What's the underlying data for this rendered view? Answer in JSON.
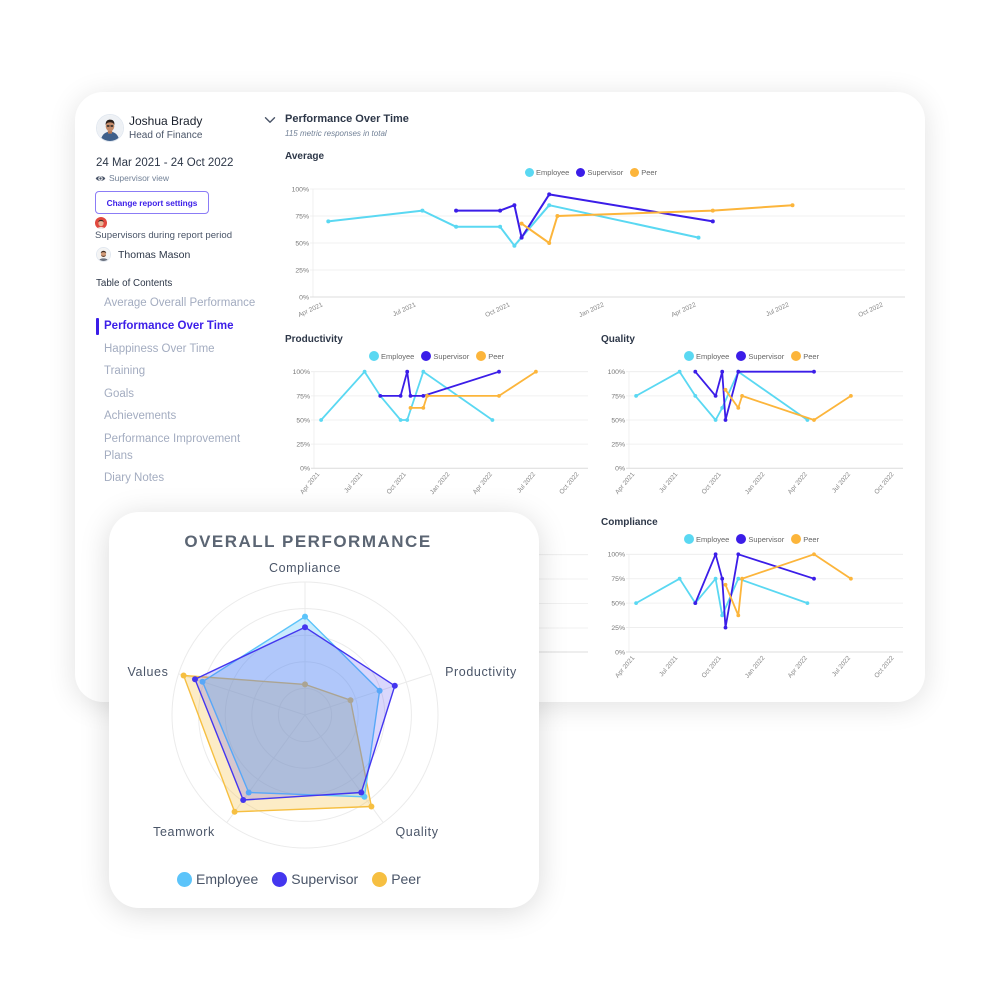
{
  "profile": {
    "name": "Joshua Brady",
    "role": "Head of Finance"
  },
  "report": {
    "date_range": "24 Mar 2021 - 24 Oct 2022",
    "view_label": "Supervisor view",
    "change_settings_label": "Change report settings",
    "supervisors_heading": "Supervisors during report period",
    "supervisors": [
      {
        "name": "Thomas Mason"
      }
    ]
  },
  "toc": {
    "heading": "Table of Contents",
    "active_index": 1,
    "items": [
      "Average Overall Performance",
      "Performance Over Time",
      "Happiness Over Time",
      "Training",
      "Goals",
      "Achievements",
      "Performance Improvement Plans",
      "Diary Notes"
    ]
  },
  "section": {
    "title": "Performance Over Time",
    "subtitle": "115 metric responses in total"
  },
  "colors": {
    "Employee": "#5ad8f2",
    "Supervisor": "#3b1de8",
    "Peer": "#fcb53b"
  },
  "radar_colors": {
    "Employee": "#5cc4fa",
    "Supervisor": "#4436ef",
    "Peer": "#f6bf41"
  },
  "chart_data": [
    {
      "type": "line",
      "title": "Average",
      "x_range": [
        "2021-03-24",
        "2022-10-24"
      ],
      "ylim": [
        0,
        100
      ],
      "legend": "top-center",
      "grid": true,
      "y_ticks": [
        {
          "label": "0%",
          "value": 0
        },
        {
          "label": "25%",
          "value": 25
        },
        {
          "label": "50%",
          "value": 50
        },
        {
          "label": "75%",
          "value": 75
        },
        {
          "label": "100%",
          "value": 100
        }
      ],
      "x_ticks": [
        {
          "label": "Apr 2021",
          "date": "2021-04-01"
        },
        {
          "label": "Jul 2021",
          "date": "2021-07-01"
        },
        {
          "label": "Oct 2021",
          "date": "2021-10-01"
        },
        {
          "label": "Jan 2022",
          "date": "2022-01-01"
        },
        {
          "label": "Apr 2022",
          "date": "2022-04-01"
        },
        {
          "label": "Jul 2022",
          "date": "2022-07-01"
        },
        {
          "label": "Oct 2022",
          "date": "2022-10-01"
        }
      ],
      "series": [
        {
          "name": "Employee",
          "points": [
            [
              "2021-04-08",
              70
            ],
            [
              "2021-07-09",
              80
            ],
            [
              "2021-08-11",
              65
            ],
            [
              "2021-09-23",
              65
            ],
            [
              "2021-10-07",
              47.5
            ],
            [
              "2021-11-10",
              85
            ],
            [
              "2022-04-05",
              55
            ]
          ]
        },
        {
          "name": "Supervisor",
          "points": [
            [
              "2021-08-11",
              80
            ],
            [
              "2021-09-23",
              80
            ],
            [
              "2021-10-07",
              85
            ],
            [
              "2021-10-14",
              55
            ],
            [
              "2021-11-10",
              95
            ],
            [
              "2022-04-19",
              70
            ]
          ]
        },
        {
          "name": "Peer",
          "points": [
            [
              "2021-10-14",
              68
            ],
            [
              "2021-11-10",
              50
            ],
            [
              "2021-11-18",
              75
            ],
            [
              "2022-04-19",
              80
            ],
            [
              "2022-07-06",
              85
            ]
          ]
        }
      ]
    },
    {
      "type": "line",
      "title": "Productivity",
      "x_range": [
        "2021-03-24",
        "2022-10-24"
      ],
      "ylim": [
        0,
        100
      ],
      "legend": "top-center",
      "grid": true,
      "y_ticks": [
        {
          "label": "0%",
          "value": 0
        },
        {
          "label": "25%",
          "value": 25
        },
        {
          "label": "50%",
          "value": 50
        },
        {
          "label": "75%",
          "value": 75
        },
        {
          "label": "100%",
          "value": 100
        }
      ],
      "x_ticks": [
        {
          "label": "Apr 2021",
          "date": "2021-04-01"
        },
        {
          "label": "Jul 2021",
          "date": "2021-07-01"
        },
        {
          "label": "Oct 2021",
          "date": "2021-10-01"
        },
        {
          "label": "Jan 2022",
          "date": "2022-01-01"
        },
        {
          "label": "Apr 2022",
          "date": "2022-04-01"
        },
        {
          "label": "Jul 2022",
          "date": "2022-07-01"
        },
        {
          "label": "Oct 2022",
          "date": "2022-10-01"
        }
      ],
      "series": [
        {
          "name": "Employee",
          "points": [
            [
              "2021-04-08",
              50
            ],
            [
              "2021-07-09",
              100
            ],
            [
              "2021-08-11",
              75
            ],
            [
              "2021-09-23",
              50
            ],
            [
              "2021-10-07",
              50
            ],
            [
              "2021-11-10",
              100
            ],
            [
              "2022-04-05",
              50
            ]
          ]
        },
        {
          "name": "Supervisor",
          "points": [
            [
              "2021-08-11",
              75
            ],
            [
              "2021-09-23",
              75
            ],
            [
              "2021-10-07",
              100
            ],
            [
              "2021-10-14",
              75
            ],
            [
              "2021-11-10",
              75
            ],
            [
              "2022-04-19",
              100
            ]
          ]
        },
        {
          "name": "Peer",
          "points": [
            [
              "2021-10-14",
              62.5
            ],
            [
              "2021-11-10",
              62.5
            ],
            [
              "2021-11-18",
              75
            ],
            [
              "2022-04-19",
              75
            ],
            [
              "2022-07-06",
              100
            ]
          ]
        }
      ]
    },
    {
      "type": "line",
      "title": "Quality",
      "x_range": [
        "2021-03-24",
        "2022-10-24"
      ],
      "ylim": [
        0,
        100
      ],
      "legend": "top-center",
      "grid": true,
      "y_ticks": [
        {
          "label": "0%",
          "value": 0
        },
        {
          "label": "25%",
          "value": 25
        },
        {
          "label": "50%",
          "value": 50
        },
        {
          "label": "75%",
          "value": 75
        },
        {
          "label": "100%",
          "value": 100
        }
      ],
      "x_ticks": [
        {
          "label": "Apr 2021",
          "date": "2021-04-01"
        },
        {
          "label": "Jul 2021",
          "date": "2021-07-01"
        },
        {
          "label": "Oct 2021",
          "date": "2021-10-01"
        },
        {
          "label": "Jan 2022",
          "date": "2022-01-01"
        },
        {
          "label": "Apr 2022",
          "date": "2022-04-01"
        },
        {
          "label": "Jul 2022",
          "date": "2022-07-01"
        },
        {
          "label": "Oct 2022",
          "date": "2022-10-01"
        }
      ],
      "series": [
        {
          "name": "Employee",
          "points": [
            [
              "2021-04-08",
              75
            ],
            [
              "2021-07-09",
              100
            ],
            [
              "2021-08-11",
              75
            ],
            [
              "2021-09-23",
              50
            ],
            [
              "2021-10-07",
              62.5
            ],
            [
              "2021-11-10",
              100
            ],
            [
              "2022-04-05",
              50
            ]
          ]
        },
        {
          "name": "Supervisor",
          "points": [
            [
              "2021-08-11",
              100
            ],
            [
              "2021-09-23",
              75
            ],
            [
              "2021-10-07",
              100
            ],
            [
              "2021-10-14",
              50
            ],
            [
              "2021-11-10",
              100
            ],
            [
              "2022-04-19",
              100
            ]
          ]
        },
        {
          "name": "Peer",
          "points": [
            [
              "2021-10-14",
              81.25
            ],
            [
              "2021-11-10",
              62.5
            ],
            [
              "2021-11-18",
              75
            ],
            [
              "2022-04-19",
              50
            ],
            [
              "2022-07-06",
              75
            ]
          ]
        }
      ]
    },
    {
      "type": "line",
      "title": "Compliance",
      "x_range": [
        "2021-03-24",
        "2022-10-24"
      ],
      "ylim": [
        0,
        100
      ],
      "legend": "top-center",
      "grid": true,
      "y_ticks": [
        {
          "label": "0%",
          "value": 0
        },
        {
          "label": "25%",
          "value": 25
        },
        {
          "label": "50%",
          "value": 50
        },
        {
          "label": "75%",
          "value": 75
        },
        {
          "label": "100%",
          "value": 100
        }
      ],
      "x_ticks": [
        {
          "label": "Apr 2021",
          "date": "2021-04-01"
        },
        {
          "label": "Jul 2021",
          "date": "2021-07-01"
        },
        {
          "label": "Oct 2021",
          "date": "2021-10-01"
        },
        {
          "label": "Jan 2022",
          "date": "2022-01-01"
        },
        {
          "label": "Apr 2022",
          "date": "2022-04-01"
        },
        {
          "label": "Jul 2022",
          "date": "2022-07-01"
        },
        {
          "label": "Oct 2022",
          "date": "2022-10-01"
        }
      ],
      "series": [
        {
          "name": "Employee",
          "points": [
            [
              "2021-04-08",
              50
            ],
            [
              "2021-07-09",
              75
            ],
            [
              "2021-08-11",
              50
            ],
            [
              "2021-09-23",
              75
            ],
            [
              "2021-10-07",
              37.5
            ],
            [
              "2021-11-10",
              75
            ],
            [
              "2022-04-05",
              50
            ]
          ]
        },
        {
          "name": "Supervisor",
          "points": [
            [
              "2021-08-11",
              50
            ],
            [
              "2021-09-23",
              100
            ],
            [
              "2021-10-07",
              75
            ],
            [
              "2021-10-14",
              25
            ],
            [
              "2021-11-10",
              100
            ],
            [
              "2022-04-19",
              75
            ]
          ]
        },
        {
          "name": "Peer",
          "points": [
            [
              "2021-10-14",
              68.75
            ],
            [
              "2021-11-10",
              37.5
            ],
            [
              "2021-11-18",
              75
            ],
            [
              "2022-04-19",
              100
            ],
            [
              "2022-07-06",
              75
            ]
          ]
        }
      ]
    },
    {
      "type": "radar",
      "title": "OVERALL PERFORMANCE",
      "axes": [
        "Compliance",
        "Productivity",
        "Quality",
        "Teamwork",
        "Values"
      ],
      "rlim": [
        0,
        100
      ],
      "rings": 5,
      "legend": "bottom-center",
      "series": [
        {
          "name": "Employee",
          "values": [
            74,
            59,
            76,
            72,
            81
          ]
        },
        {
          "name": "Supervisor",
          "values": [
            66,
            71,
            72,
            79,
            87
          ]
        },
        {
          "name": "Peer",
          "values": [
            23,
            36,
            85,
            90,
            96
          ]
        }
      ]
    }
  ]
}
